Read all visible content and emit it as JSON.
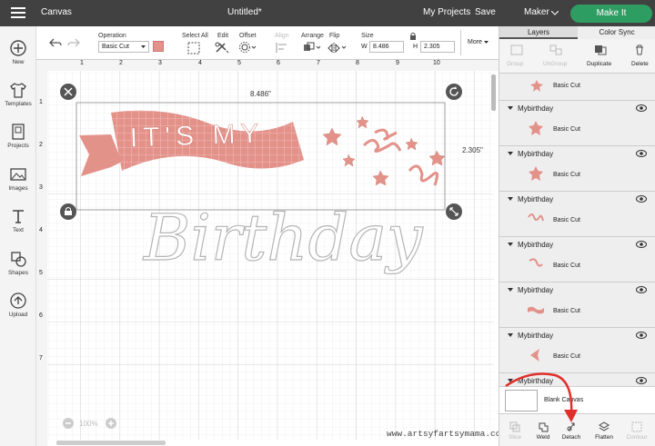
{
  "app": {
    "menu_icon": "hamburger-icon",
    "section": "Canvas",
    "title": "Untitled*",
    "my_projects": "My Projects",
    "save": "Save",
    "machine": "Maker",
    "make_it": "Make It"
  },
  "toolbar": {
    "operation_label": "Operation",
    "operation_value": "Basic Cut",
    "select_all": "Select All",
    "edit": "Edit",
    "offset": "Offset",
    "align": "Align",
    "arrange": "Arrange",
    "flip": "Flip",
    "size": "Size",
    "w_label": "W",
    "w_value": "8.486",
    "h_label": "H",
    "h_value": "2.305",
    "more": "More"
  },
  "leftbar": [
    {
      "label": "New",
      "icon": "plus-icon"
    },
    {
      "label": "Templates",
      "icon": "shirt-icon"
    },
    {
      "label": "Projects",
      "icon": "projects-icon"
    },
    {
      "label": "Images",
      "icon": "image-icon"
    },
    {
      "label": "Text",
      "icon": "text-icon"
    },
    {
      "label": "Shapes",
      "icon": "shapes-icon"
    },
    {
      "label": "Upload",
      "icon": "upload-icon"
    }
  ],
  "canvas": {
    "ruler_top": [
      "1",
      "2",
      "3",
      "4",
      "5",
      "6",
      "7",
      "8",
      "9",
      "10"
    ],
    "ruler_left": [
      "1",
      "2",
      "3",
      "4",
      "5",
      "6",
      "7"
    ],
    "width_dim": "8.486\"",
    "height_dim": "2.305\"",
    "banner_text": "IT'S MY",
    "word": "Birthday",
    "zoom": "100%",
    "watermark": "www.artsyfartsymama.com"
  },
  "panel": {
    "tab_layers": "Layers",
    "tab_color_sync": "Color Sync",
    "actions": [
      "Group",
      "UnGroup",
      "Duplicate",
      "Delete"
    ],
    "top_item": "Basic Cut",
    "layers": [
      {
        "group": "Mybirthday",
        "sub": "Basic Cut"
      },
      {
        "group": "Mybirthday",
        "sub": "Basic Cut"
      },
      {
        "group": "Mybirthday",
        "sub": "Basic Cut"
      },
      {
        "group": "Mybirthday",
        "sub": "Basic Cut"
      },
      {
        "group": "Mybirthday",
        "sub": "Basic Cut"
      },
      {
        "group": "Mybirthday",
        "sub": "Basic Cut"
      },
      {
        "group": "Mybirthday",
        "sub": ""
      }
    ],
    "blank_canvas": "Blank Canvas",
    "bottom": [
      "Slice",
      "Weld",
      "Detach",
      "Flatten",
      "Contour"
    ]
  },
  "colors": {
    "accent": "#e3928a",
    "topbar": "#414141",
    "make_it": "#2d9d62",
    "annotation": "#e0302b"
  }
}
